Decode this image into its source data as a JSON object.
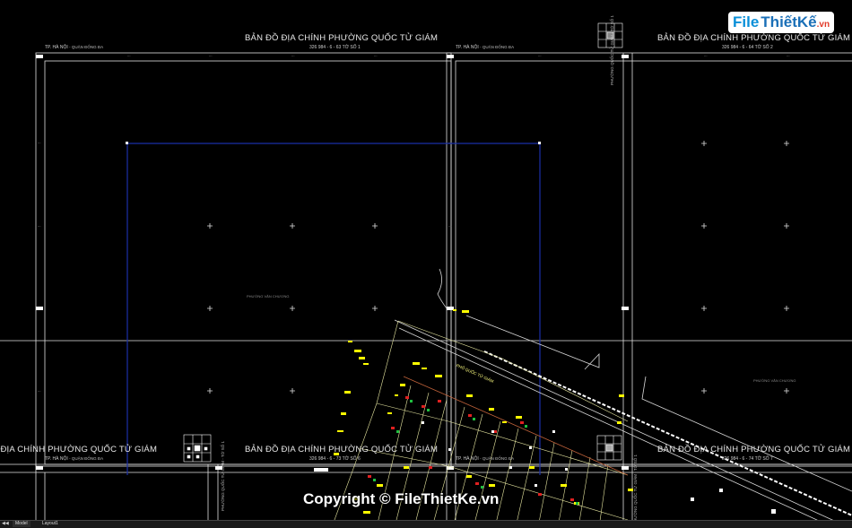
{
  "sheets": {
    "title": "BẢN ĐỒ ĐỊA CHÍNH PHƯỜNG QUỐC TỬ GIÁM",
    "city_label": "TP. HÀ NỘI",
    "district_label": "- QUẬN ĐỐNG ĐA",
    "codes": {
      "s1": "326 984 - 6 - 63 TỜ SỐ 1",
      "s2": "326 984 - 6 - 64 TỜ SỐ 2",
      "s6": "326 984 - 6 - 73 TỜ SỐ 6",
      "s7": "326 984 - 6 - 74 TỜ SỐ 7"
    },
    "side_label": "PHƯỜNG QUỐC TỬ GIÁM - TỜ SỐ 1"
  },
  "map_labels": {
    "ward_a": "PHƯỜNG VĂN CHƯƠNG",
    "ward_b": "PHƯỜNG VĂN CHƯƠNG",
    "street": "PHỐ QUỐC TỬ GIÁM"
  },
  "watermark": {
    "logo_main": "File",
    "logo_brand": "ThiếtKế",
    "logo_suffix": ".vn",
    "copyright": "Copyright © FileThietKe.vn"
  },
  "layout_tabs": {
    "model": "Model",
    "layout1": "Layout1"
  },
  "colors": {
    "background": "#000000",
    "frame": "#ffffff",
    "viewport": "#1a2fa8",
    "parcels": "#e6e6a0",
    "labels": "#ffff00",
    "boundary": "#c0623a"
  }
}
